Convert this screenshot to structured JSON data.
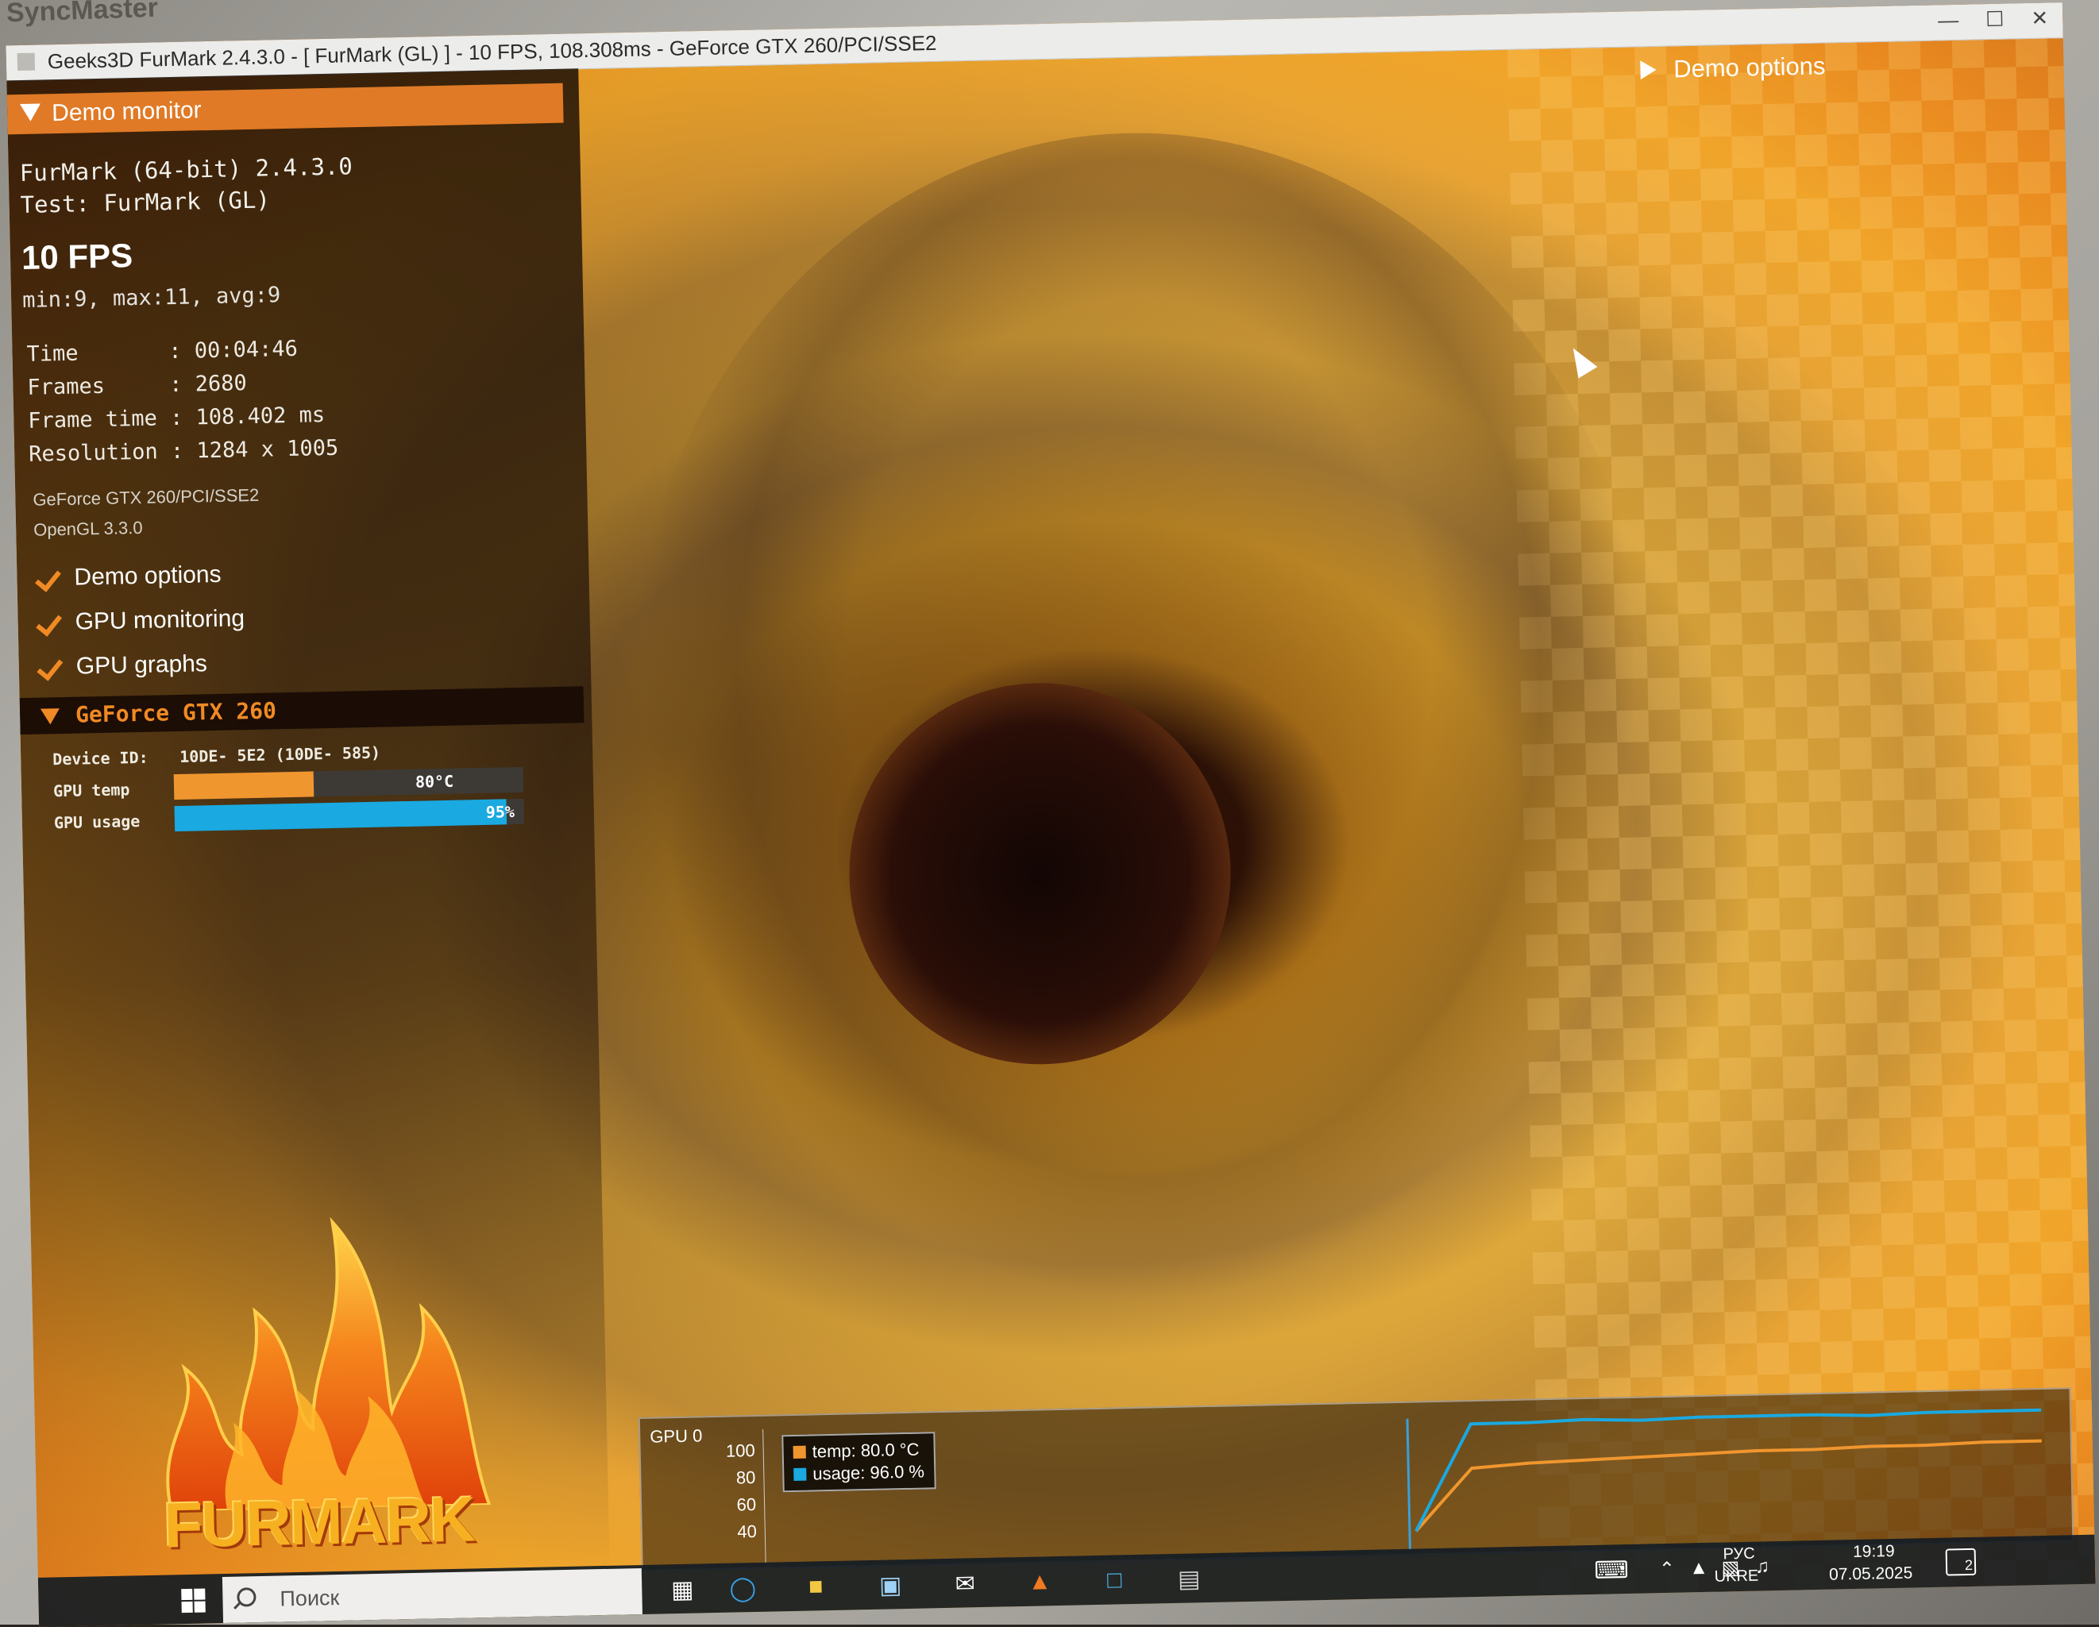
{
  "bezel_label": "SyncMaster",
  "window": {
    "title": "Geeks3D FurMark 2.4.3.0 - [ FurMark (GL) ] - 10 FPS, 108.308ms - GeForce GTX 260/PCI/SSE2"
  },
  "demo_monitor": {
    "header": "Demo monitor",
    "app_version": "FurMark (64-bit) 2.4.3.0",
    "test": "Test: FurMark (GL)",
    "fps": "10 FPS",
    "fps_stats": "min:9, max:11, avg:9",
    "stats": [
      "Time       : 00:04:46",
      "Frames     : 2680",
      "Frame time : 108.402 ms",
      "Resolution : 1284 x 1005"
    ],
    "gpu_name": "GeForce GTX 260/PCI/SSE2",
    "gl_version": "OpenGL 3.3.0",
    "options": [
      "Demo options",
      "GPU monitoring",
      "GPU graphs"
    ]
  },
  "gpu_panel": {
    "title": "GeForce GTX 260",
    "device_id_label": "Device ID:",
    "device_id_value": "10DE- 5E2 (10DE- 585)",
    "temp_label": "GPU temp",
    "temp_value": "80°C",
    "temp_fraction": 0.4,
    "usage_label": "GPU usage",
    "usage_value": "95%",
    "usage_fraction": 0.95,
    "temp_color": "#f0962e",
    "usage_color": "#1aa9e0"
  },
  "logo_text": "FURMARK",
  "demo_options_label": "Demo options",
  "graph": {
    "title": "GPU 0",
    "y_ticks": [
      "100",
      "80",
      "60",
      "40"
    ],
    "legend": [
      {
        "label": "temp: 80.0 °C",
        "color": "#f0962e"
      },
      {
        "label": "usage: 96.0 %",
        "color": "#1aa9e0"
      }
    ]
  },
  "chart_data": {
    "type": "line",
    "ylim": [
      30,
      100
    ],
    "series": [
      {
        "name": "temp: 80.0 °C",
        "values": [
          40,
          72,
          74,
          75,
          76,
          77,
          78,
          78,
          79,
          79,
          80,
          80
        ]
      },
      {
        "name": "usage: 96.0 %",
        "values": [
          40,
          95,
          95,
          96,
          95,
          96,
          96,
          96,
          95,
          96,
          96,
          96
        ]
      }
    ]
  },
  "taskbar": {
    "search_placeholder": "Поиск",
    "lang_1": "РУС",
    "lang_2": "UKRE",
    "time": "19:19",
    "date": "07.05.2025",
    "notification_count": "2"
  }
}
